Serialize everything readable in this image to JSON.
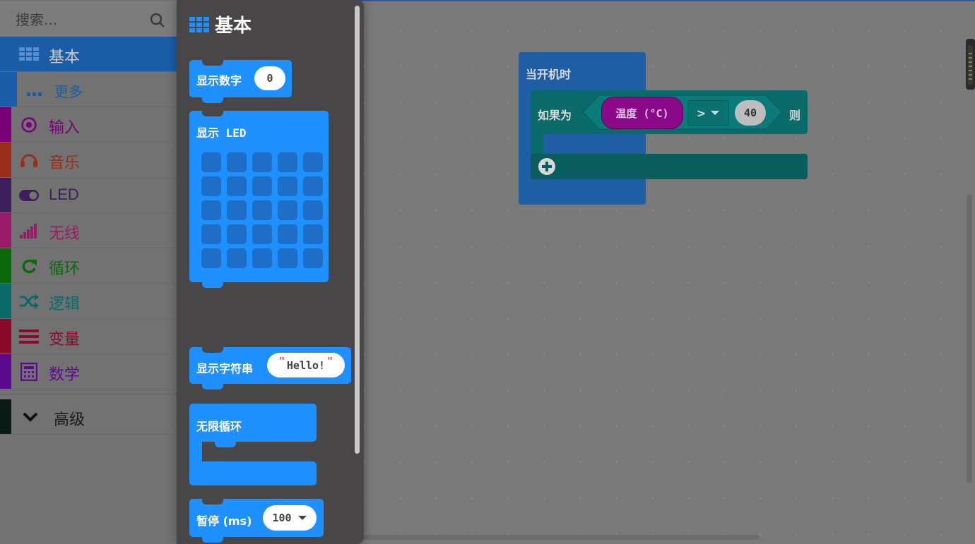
{
  "search": {
    "placeholder": "搜索..."
  },
  "categories": [
    {
      "label": "基本",
      "icon": "grid-icon",
      "color": "#1e90ff"
    },
    {
      "label": "更多",
      "icon": "more-dots-icon",
      "color": "#1e90ff"
    },
    {
      "label": "输入",
      "icon": "target-circle-icon",
      "color": "#b000b0"
    },
    {
      "label": "音乐",
      "icon": "headphones-icon",
      "color": "#d6432a"
    },
    {
      "label": "LED",
      "icon": "toggle-icon",
      "color": "#5b2a8a"
    },
    {
      "label": "无线",
      "icon": "signal-bars-icon",
      "color": "#e0208a"
    },
    {
      "label": "循环",
      "icon": "refresh-icon",
      "color": "#00aa00"
    },
    {
      "label": "逻辑",
      "icon": "shuffle-icon",
      "color": "#00a4a6"
    },
    {
      "label": "变量",
      "icon": "lines-icon",
      "color": "#dc143c"
    },
    {
      "label": "数学",
      "icon": "calculator-icon",
      "color": "#9400d3"
    },
    {
      "label": "高级",
      "icon": "chevron-down-icon",
      "color": "#000000"
    }
  ],
  "flyout": {
    "title": "基本",
    "blocks": {
      "show_number": {
        "label": "显示数字",
        "value": "0"
      },
      "show_leds": {
        "label": "显示 LED"
      },
      "show_string": {
        "label": "显示字符串",
        "value": "Hello!",
        "quote": "\""
      },
      "forever": {
        "label": "无限循环"
      },
      "pause": {
        "label": "暂停 (ms)",
        "value": "100"
      }
    }
  },
  "workspace": {
    "on_start": {
      "label": "当开机时"
    },
    "if_block": {
      "if_label": "如果为",
      "sensor": "温度 (°C)",
      "operator": ">",
      "value": "40",
      "then_label": "则"
    }
  },
  "colors": {
    "basic": "#1e90ff",
    "logic": "#00a4a6",
    "input": "#b000b0"
  }
}
